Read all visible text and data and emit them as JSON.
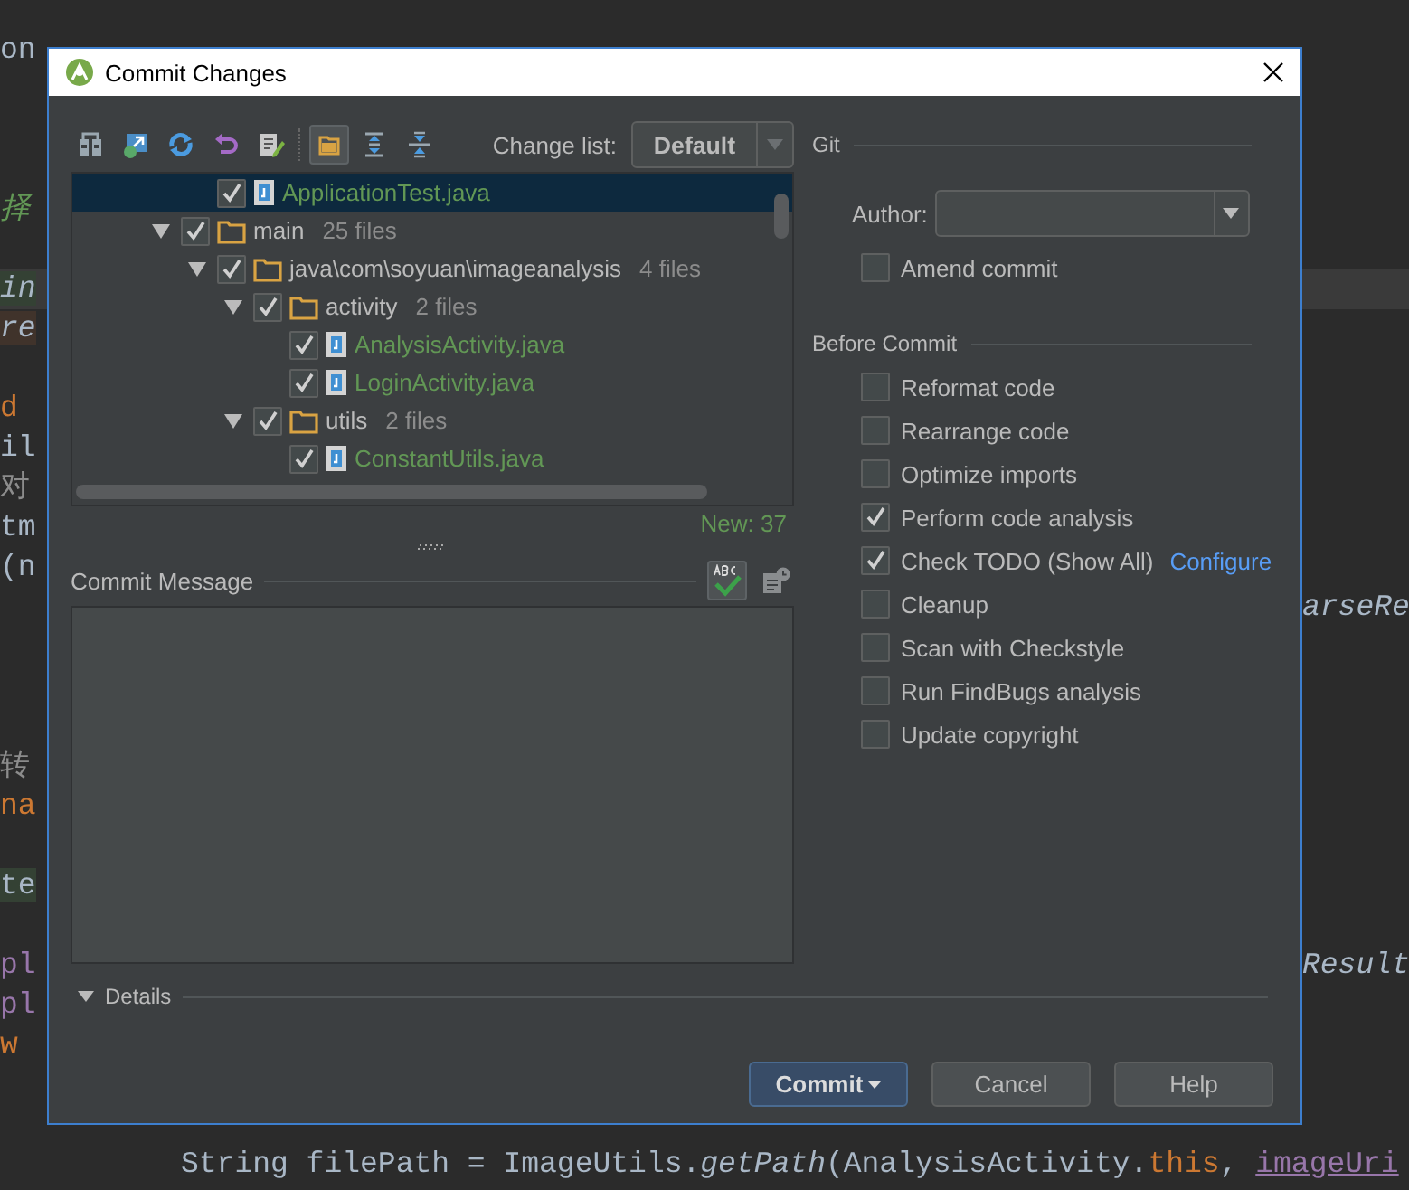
{
  "window": {
    "title": "Commit Changes"
  },
  "toolbar": {
    "buttons": [
      {
        "kind": "diff",
        "selected": false
      },
      {
        "kind": "move",
        "selected": false
      },
      {
        "kind": "refresh",
        "selected": false
      },
      {
        "kind": "revert",
        "selected": false
      },
      {
        "kind": "edit",
        "selected": false
      },
      {
        "kind": "group",
        "selected": true
      },
      {
        "kind": "expand",
        "selected": false
      },
      {
        "kind": "collapse",
        "selected": false
      }
    ],
    "change_list_label": "Change list:",
    "change_list_value": "Default"
  },
  "tree": [
    {
      "children": [
        {
          "kind": "file",
          "name": "ApplicationTest.java",
          "checked": true,
          "selected": true
        }
      ]
    },
    {
      "kind": "folder",
      "name": "main",
      "count": "25 files",
      "checked": true,
      "selected": false,
      "expanded": true,
      "children": [
        {
          "kind": "folder",
          "name": "java\\com\\soyuan\\imageanalysis",
          "count": "4 files",
          "checked": true,
          "selected": false,
          "expanded": true,
          "children": [
            {
              "kind": "folder",
              "name": "activity",
              "count": "2 files",
              "checked": true,
              "selected": false,
              "expanded": true,
              "children": [
                {
                  "kind": "file",
                  "name": "AnalysisActivity.java",
                  "checked": true,
                  "selected": false
                },
                {
                  "kind": "file",
                  "name": "LoginActivity.java",
                  "checked": true,
                  "selected": false
                }
              ]
            },
            {
              "kind": "folder",
              "name": "utils",
              "count": "2 files",
              "checked": true,
              "selected": false,
              "expanded": true,
              "children": [
                {
                  "kind": "file",
                  "name": "ConstantUtils.java",
                  "checked": true,
                  "selected": false
                }
              ]
            }
          ]
        }
      ]
    }
  ],
  "new_count": "New: 37",
  "commit_message": {
    "label": "Commit Message"
  },
  "git": {
    "title": "Git",
    "author_label": "Author:",
    "amend": {
      "label": "Amend commit",
      "checked": false
    }
  },
  "before_commit": {
    "title": "Before Commit",
    "options": [
      {
        "label": "Reformat code",
        "checked": false
      },
      {
        "label": "Rearrange code",
        "checked": false
      },
      {
        "label": "Optimize imports",
        "checked": false
      },
      {
        "label": "Perform code analysis",
        "checked": true
      },
      {
        "label": "Check TODO (Show All)",
        "checked": true,
        "link": "Configure"
      },
      {
        "label": "Cleanup",
        "checked": false
      },
      {
        "label": "Scan with Checkstyle",
        "checked": false
      },
      {
        "label": "Run FindBugs analysis",
        "checked": false
      },
      {
        "label": "Update copyright",
        "checked": false
      }
    ]
  },
  "details": {
    "label": "Details"
  },
  "buttons": [
    {
      "label": "Commit",
      "kind": "primary"
    },
    {
      "label": "Cancel",
      "kind": "normal"
    },
    {
      "label": "Help",
      "kind": "normal"
    }
  ],
  "editor": {
    "lines": [
      {
        "kind": "code",
        "current": false,
        "left": [
          {
            "text": "on",
            "kind": "plain"
          }
        ]
      },
      {
        "kind": "blank"
      },
      {
        "kind": "blank"
      },
      {
        "kind": "blank"
      },
      {
        "kind": "code",
        "current": false,
        "left": [
          {
            "text": "择",
            "kind": "comment"
          }
        ]
      },
      {
        "kind": "blank"
      },
      {
        "kind": "code",
        "current": true,
        "left": [
          {
            "text": "in",
            "kind": "param_read"
          }
        ]
      },
      {
        "kind": "code",
        "current": false,
        "left": [
          {
            "text": "re",
            "kind": "param_write"
          }
        ]
      },
      {
        "kind": "blank"
      },
      {
        "kind": "code",
        "current": false,
        "left": [
          {
            "text": "d",
            "kind": "keyword"
          }
        ]
      },
      {
        "kind": "code",
        "current": false,
        "left": [
          {
            "text": "il",
            "kind": "plain"
          }
        ]
      },
      {
        "kind": "code",
        "current": false,
        "left": [
          {
            "text": "对",
            "kind": "doc"
          }
        ]
      },
      {
        "kind": "code",
        "current": false,
        "left": [
          {
            "text": "tm",
            "kind": "plain"
          }
        ]
      },
      {
        "kind": "code",
        "current": false,
        "left": [
          {
            "text": "(n",
            "kind": "plain"
          }
        ]
      },
      {
        "kind": "code",
        "current": false,
        "right": [
          {
            "text": "arseRe",
            "kind": "italic"
          }
        ]
      },
      {
        "kind": "blank"
      },
      {
        "kind": "blank"
      },
      {
        "kind": "blank"
      },
      {
        "kind": "code",
        "current": false,
        "left": [
          {
            "text": "转",
            "kind": "doc"
          }
        ]
      },
      {
        "kind": "code",
        "current": false,
        "left": [
          {
            "text": "na",
            "kind": "keyword"
          }
        ]
      },
      {
        "kind": "blank"
      },
      {
        "kind": "code",
        "current": false,
        "left": [
          {
            "text": "te",
            "kind": "usage"
          }
        ]
      },
      {
        "kind": "blank"
      },
      {
        "kind": "code",
        "current": false,
        "left": [
          {
            "text": "pl",
            "kind": "field"
          }
        ],
        "right": [
          {
            "text": "Result",
            "kind": "italic"
          }
        ]
      },
      {
        "kind": "code",
        "current": false,
        "left": [
          {
            "text": "pl",
            "kind": "field"
          }
        ]
      },
      {
        "kind": "code",
        "current": false,
        "left": [
          {
            "text": "w",
            "kind": "keyword"
          }
        ]
      },
      {
        "kind": "blank"
      },
      {
        "kind": "blank"
      },
      {
        "kind": "statement",
        "current": false,
        "left": [
          {
            "text": "String filePath = ImageUtils.",
            "kind": "plain"
          },
          {
            "text": "getPath",
            "kind": "italic"
          },
          {
            "text": "(AnalysisActivity.",
            "kind": "plain"
          },
          {
            "text": "this",
            "kind": "keyword"
          },
          {
            "text": ", ",
            "kind": "plain"
          },
          {
            "text": "imageUri",
            "kind": "link_field"
          }
        ]
      }
    ]
  }
}
